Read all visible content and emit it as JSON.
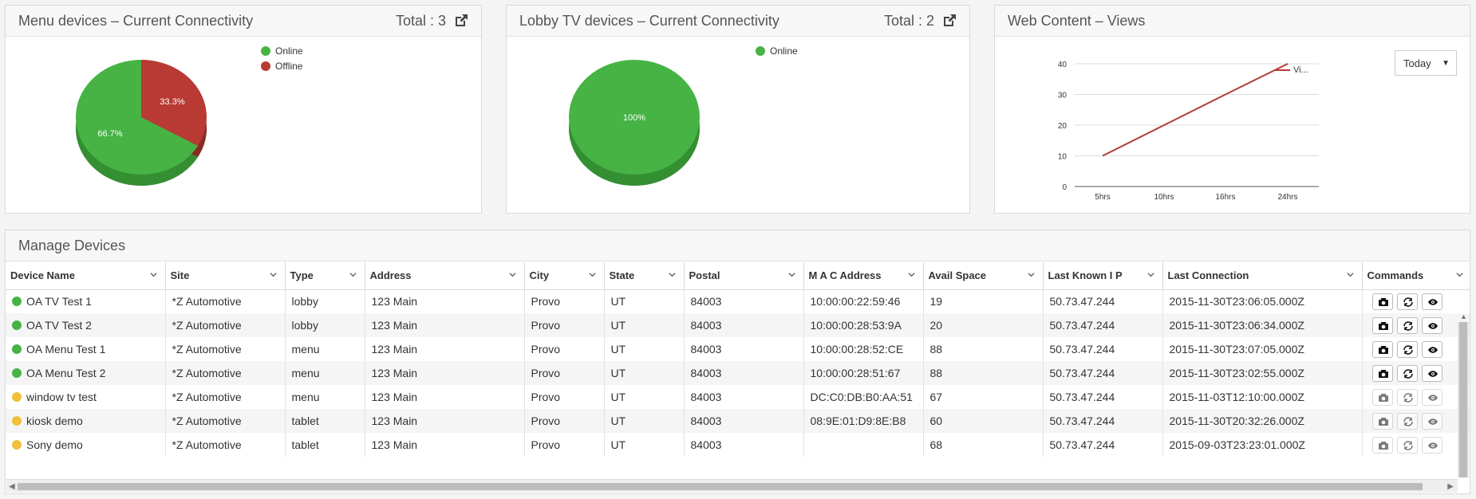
{
  "panels": {
    "menu": {
      "title": "Menu devices – Current Connectivity",
      "total": "Total : 3",
      "legend": [
        {
          "label": "Online",
          "color": "#46b344"
        },
        {
          "label": "Offline",
          "color": "#b83a33"
        }
      ],
      "slices": {
        "offline": "33.3%",
        "online": "66.7%"
      }
    },
    "lobby": {
      "title": "Lobby TV devices – Current Connectivity",
      "total": "Total : 2",
      "legend": [
        {
          "label": "Online",
          "color": "#46b344"
        }
      ],
      "slices": {
        "online": "100%"
      }
    },
    "web": {
      "title": "Web Content – Views",
      "select": "Today",
      "legend": "Vi..."
    }
  },
  "chart_data": [
    {
      "type": "pie",
      "categories": [
        "Online",
        "Offline"
      ],
      "values": [
        66.7,
        33.3
      ]
    },
    {
      "type": "pie",
      "categories": [
        "Online"
      ],
      "values": [
        100
      ]
    },
    {
      "type": "line",
      "categories": [
        "5hrs",
        "10hrs",
        "16hrs",
        "24hrs"
      ],
      "series": [
        {
          "name": "Vi...",
          "values": [
            10,
            20,
            30,
            40
          ]
        }
      ],
      "ylim": [
        0,
        40
      ],
      "yticks": [
        "0",
        "10",
        "20",
        "30",
        "40"
      ],
      "grid": true,
      "legend": "right"
    }
  ],
  "manage": {
    "title": "Manage Devices",
    "columns": [
      "Device Name",
      "Site",
      "Type",
      "Address",
      "City",
      "State",
      "Postal",
      "M A C Address",
      "Avail Space",
      "Last Known I P",
      "Last Connection",
      "Commands"
    ],
    "rows": [
      {
        "status": "#46b344",
        "name": "OA TV Test 1",
        "site": "*Z Automotive",
        "type": "lobby",
        "address": "123 Main",
        "city": "Provo",
        "state": "UT",
        "postal": "84003",
        "mac": "10:00:00:22:59:46",
        "space": "19",
        "ip": "50.73.47.244",
        "last": "2015-11-30T23:06:05.000Z",
        "active": true
      },
      {
        "status": "#46b344",
        "name": "OA TV Test 2",
        "site": "*Z Automotive",
        "type": "lobby",
        "address": "123 Main",
        "city": "Provo",
        "state": "UT",
        "postal": "84003",
        "mac": "10:00:00:28:53:9A",
        "space": "20",
        "ip": "50.73.47.244",
        "last": "2015-11-30T23:06:34.000Z",
        "active": true
      },
      {
        "status": "#46b344",
        "name": "OA Menu Test 1",
        "site": "*Z Automotive",
        "type": "menu",
        "address": "123 Main",
        "city": "Provo",
        "state": "UT",
        "postal": "84003",
        "mac": "10:00:00:28:52:CE",
        "space": "88",
        "ip": "50.73.47.244",
        "last": "2015-11-30T23:07:05.000Z",
        "active": true
      },
      {
        "status": "#46b344",
        "name": "OA Menu Test 2",
        "site": "*Z Automotive",
        "type": "menu",
        "address": "123 Main",
        "city": "Provo",
        "state": "UT",
        "postal": "84003",
        "mac": "10:00:00:28:51:67",
        "space": "88",
        "ip": "50.73.47.244",
        "last": "2015-11-30T23:02:55.000Z",
        "active": true
      },
      {
        "status": "#f0c03a",
        "name": "window tv test",
        "site": "*Z Automotive",
        "type": "menu",
        "address": "123 Main",
        "city": "Provo",
        "state": "UT",
        "postal": "84003",
        "mac": "DC:C0:DB:B0:AA:51",
        "space": "67",
        "ip": "50.73.47.244",
        "last": "2015-11-03T12:10:00.000Z",
        "active": false
      },
      {
        "status": "#f0c03a",
        "name": "kiosk demo",
        "site": "*Z Automotive",
        "type": "tablet",
        "address": "123 Main",
        "city": "Provo",
        "state": "UT",
        "postal": "84003",
        "mac": "08:9E:01:D9:8E:B8",
        "space": "60",
        "ip": "50.73.47.244",
        "last": "2015-11-30T20:32:26.000Z",
        "active": false
      },
      {
        "status": "#f0c03a",
        "name": "Sony demo",
        "site": "*Z Automotive",
        "type": "tablet",
        "address": "123 Main",
        "city": "Provo",
        "state": "UT",
        "postal": "84003",
        "mac": "",
        "space": "68",
        "ip": "50.73.47.244",
        "last": "2015-09-03T23:23:01.000Z",
        "active": false
      }
    ]
  }
}
